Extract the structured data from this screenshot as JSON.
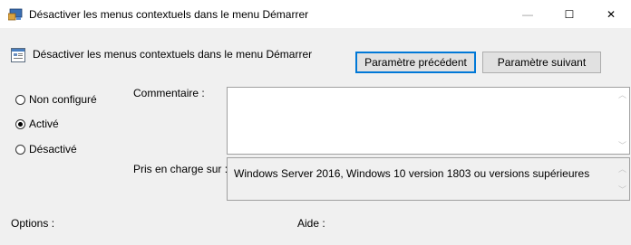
{
  "window": {
    "title": "Désactiver les menus contextuels dans le menu Démarrer",
    "minimize_glyph": "—",
    "maximize_glyph": "☐",
    "close_glyph": "✕"
  },
  "header": {
    "title": "Désactiver les menus contextuels dans le menu Démarrer",
    "prev_button": "Paramètre précédent",
    "next_button": "Paramètre suivant"
  },
  "state": {
    "options": [
      {
        "label": "Non configuré",
        "checked": false
      },
      {
        "label": "Activé",
        "checked": true
      },
      {
        "label": "Désactivé",
        "checked": false
      }
    ]
  },
  "comment": {
    "label": "Commentaire :",
    "value": ""
  },
  "supported": {
    "label": "Pris en charge sur :",
    "value": "Windows Server 2016, Windows 10 version 1803 ou versions supérieures"
  },
  "footer": {
    "options_label": "Options :",
    "help_label": "Aide :"
  },
  "icons": {
    "window_icon": "policy-icon",
    "header_icon": "setting-icon"
  }
}
